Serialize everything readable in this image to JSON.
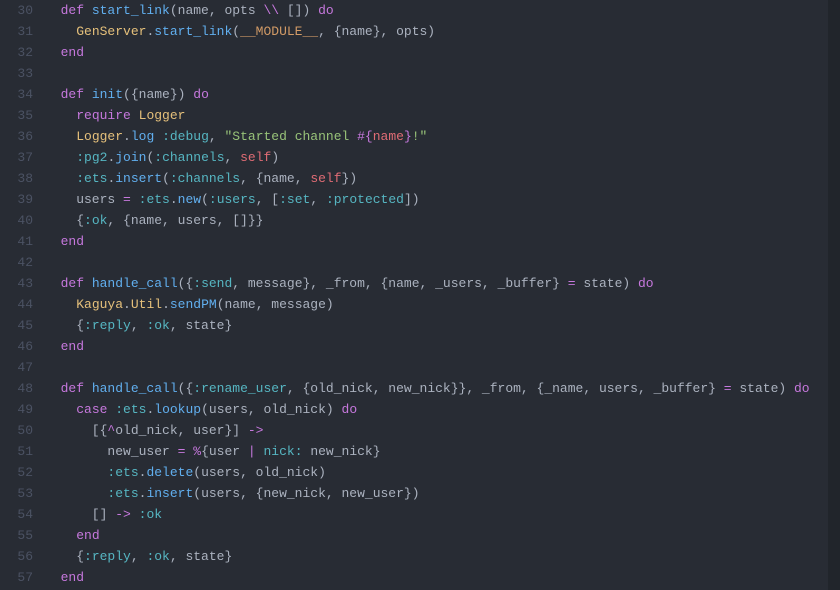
{
  "line_numbers": [
    "30",
    "31",
    "32",
    "33",
    "34",
    "35",
    "36",
    "37",
    "38",
    "39",
    "40",
    "41",
    "42",
    "43",
    "44",
    "45",
    "46",
    "47",
    "48",
    "49",
    "50",
    "51",
    "52",
    "53",
    "54",
    "55",
    "56",
    "57"
  ],
  "tokens": [
    [
      {
        "c": "punc",
        "t": "  "
      },
      {
        "c": "kw",
        "t": "def"
      },
      {
        "c": "punc",
        "t": " "
      },
      {
        "c": "fn",
        "t": "start_link"
      },
      {
        "c": "punc",
        "t": "(name, opts "
      },
      {
        "c": "op",
        "t": "\\\\"
      },
      {
        "c": "punc",
        "t": " []) "
      },
      {
        "c": "kw",
        "t": "do"
      }
    ],
    [
      {
        "c": "punc",
        "t": "    "
      },
      {
        "c": "mod",
        "t": "GenServer"
      },
      {
        "c": "punc",
        "t": "."
      },
      {
        "c": "fn",
        "t": "start_link"
      },
      {
        "c": "punc",
        "t": "("
      },
      {
        "c": "const",
        "t": "__MODULE__"
      },
      {
        "c": "punc",
        "t": ", {name}, opts)"
      }
    ],
    [
      {
        "c": "punc",
        "t": "  "
      },
      {
        "c": "kw",
        "t": "end"
      }
    ],
    [],
    [
      {
        "c": "punc",
        "t": "  "
      },
      {
        "c": "kw",
        "t": "def"
      },
      {
        "c": "punc",
        "t": " "
      },
      {
        "c": "fn",
        "t": "init"
      },
      {
        "c": "punc",
        "t": "({name}) "
      },
      {
        "c": "kw",
        "t": "do"
      }
    ],
    [
      {
        "c": "punc",
        "t": "    "
      },
      {
        "c": "kw",
        "t": "require"
      },
      {
        "c": "punc",
        "t": " "
      },
      {
        "c": "mod",
        "t": "Logger"
      }
    ],
    [
      {
        "c": "punc",
        "t": "    "
      },
      {
        "c": "mod",
        "t": "Logger"
      },
      {
        "c": "punc",
        "t": "."
      },
      {
        "c": "fn",
        "t": "log"
      },
      {
        "c": "punc",
        "t": " "
      },
      {
        "c": "atom",
        "t": ":debug"
      },
      {
        "c": "punc",
        "t": ", "
      },
      {
        "c": "str",
        "t": "\"Started channel "
      },
      {
        "c": "interp",
        "t": "#{"
      },
      {
        "c": "var",
        "t": "name"
      },
      {
        "c": "interp",
        "t": "}"
      },
      {
        "c": "str",
        "t": "!\""
      }
    ],
    [
      {
        "c": "punc",
        "t": "    "
      },
      {
        "c": "atom",
        "t": ":pg2"
      },
      {
        "c": "punc",
        "t": "."
      },
      {
        "c": "fn",
        "t": "join"
      },
      {
        "c": "punc",
        "t": "("
      },
      {
        "c": "atom",
        "t": ":channels"
      },
      {
        "c": "punc",
        "t": ", "
      },
      {
        "c": "var",
        "t": "self"
      },
      {
        "c": "punc",
        "t": ")"
      }
    ],
    [
      {
        "c": "punc",
        "t": "    "
      },
      {
        "c": "atom",
        "t": ":ets"
      },
      {
        "c": "punc",
        "t": "."
      },
      {
        "c": "fn",
        "t": "insert"
      },
      {
        "c": "punc",
        "t": "("
      },
      {
        "c": "atom",
        "t": ":channels"
      },
      {
        "c": "punc",
        "t": ", {name, "
      },
      {
        "c": "var",
        "t": "self"
      },
      {
        "c": "punc",
        "t": "})"
      }
    ],
    [
      {
        "c": "punc",
        "t": "    users "
      },
      {
        "c": "op",
        "t": "="
      },
      {
        "c": "punc",
        "t": " "
      },
      {
        "c": "atom",
        "t": ":ets"
      },
      {
        "c": "punc",
        "t": "."
      },
      {
        "c": "fn",
        "t": "new"
      },
      {
        "c": "punc",
        "t": "("
      },
      {
        "c": "atom",
        "t": ":users"
      },
      {
        "c": "punc",
        "t": ", ["
      },
      {
        "c": "atom",
        "t": ":set"
      },
      {
        "c": "punc",
        "t": ", "
      },
      {
        "c": "atom",
        "t": ":protected"
      },
      {
        "c": "punc",
        "t": "])"
      }
    ],
    [
      {
        "c": "punc",
        "t": "    {"
      },
      {
        "c": "atom",
        "t": ":ok"
      },
      {
        "c": "punc",
        "t": ", {name, users, []}}"
      }
    ],
    [
      {
        "c": "punc",
        "t": "  "
      },
      {
        "c": "kw",
        "t": "end"
      }
    ],
    [],
    [
      {
        "c": "punc",
        "t": "  "
      },
      {
        "c": "kw",
        "t": "def"
      },
      {
        "c": "punc",
        "t": " "
      },
      {
        "c": "fn",
        "t": "handle_call"
      },
      {
        "c": "punc",
        "t": "({"
      },
      {
        "c": "atom",
        "t": ":send"
      },
      {
        "c": "punc",
        "t": ", message}, _from, {name, _users, _buffer} "
      },
      {
        "c": "op",
        "t": "="
      },
      {
        "c": "punc",
        "t": " state) "
      },
      {
        "c": "kw",
        "t": "do"
      }
    ],
    [
      {
        "c": "punc",
        "t": "    "
      },
      {
        "c": "mod",
        "t": "Kaguya"
      },
      {
        "c": "punc",
        "t": "."
      },
      {
        "c": "mod",
        "t": "Util"
      },
      {
        "c": "punc",
        "t": "."
      },
      {
        "c": "fn",
        "t": "sendPM"
      },
      {
        "c": "punc",
        "t": "(name, message)"
      }
    ],
    [
      {
        "c": "punc",
        "t": "    {"
      },
      {
        "c": "atom",
        "t": ":reply"
      },
      {
        "c": "punc",
        "t": ", "
      },
      {
        "c": "atom",
        "t": ":ok"
      },
      {
        "c": "punc",
        "t": ", state}"
      }
    ],
    [
      {
        "c": "punc",
        "t": "  "
      },
      {
        "c": "kw",
        "t": "end"
      }
    ],
    [],
    [
      {
        "c": "punc",
        "t": "  "
      },
      {
        "c": "kw",
        "t": "def"
      },
      {
        "c": "punc",
        "t": " "
      },
      {
        "c": "fn",
        "t": "handle_call"
      },
      {
        "c": "punc",
        "t": "({"
      },
      {
        "c": "atom",
        "t": ":rename_user"
      },
      {
        "c": "punc",
        "t": ", {old_nick, new_nick}}, _from, {_name, users, _buffer} "
      },
      {
        "c": "op",
        "t": "="
      },
      {
        "c": "punc",
        "t": " state) "
      },
      {
        "c": "kw",
        "t": "do"
      }
    ],
    [
      {
        "c": "punc",
        "t": "    "
      },
      {
        "c": "kw",
        "t": "case"
      },
      {
        "c": "punc",
        "t": " "
      },
      {
        "c": "atom",
        "t": ":ets"
      },
      {
        "c": "punc",
        "t": "."
      },
      {
        "c": "fn",
        "t": "lookup"
      },
      {
        "c": "punc",
        "t": "(users, old_nick) "
      },
      {
        "c": "kw",
        "t": "do"
      }
    ],
    [
      {
        "c": "punc",
        "t": "      [{"
      },
      {
        "c": "op",
        "t": "^"
      },
      {
        "c": "punc",
        "t": "old_nick, user}] "
      },
      {
        "c": "op",
        "t": "->"
      }
    ],
    [
      {
        "c": "punc",
        "t": "        new_user "
      },
      {
        "c": "op",
        "t": "="
      },
      {
        "c": "punc",
        "t": " "
      },
      {
        "c": "op",
        "t": "%"
      },
      {
        "c": "punc",
        "t": "{user "
      },
      {
        "c": "op",
        "t": "|"
      },
      {
        "c": "punc",
        "t": " "
      },
      {
        "c": "atom",
        "t": "nick:"
      },
      {
        "c": "punc",
        "t": " new_nick}"
      }
    ],
    [
      {
        "c": "punc",
        "t": "        "
      },
      {
        "c": "atom",
        "t": ":ets"
      },
      {
        "c": "punc",
        "t": "."
      },
      {
        "c": "fn",
        "t": "delete"
      },
      {
        "c": "punc",
        "t": "(users, old_nick)"
      }
    ],
    [
      {
        "c": "punc",
        "t": "        "
      },
      {
        "c": "atom",
        "t": ":ets"
      },
      {
        "c": "punc",
        "t": "."
      },
      {
        "c": "fn",
        "t": "insert"
      },
      {
        "c": "punc",
        "t": "(users, {new_nick, new_user})"
      }
    ],
    [
      {
        "c": "punc",
        "t": "      [] "
      },
      {
        "c": "op",
        "t": "->"
      },
      {
        "c": "punc",
        "t": " "
      },
      {
        "c": "atom",
        "t": ":ok"
      }
    ],
    [
      {
        "c": "punc",
        "t": "    "
      },
      {
        "c": "kw",
        "t": "end"
      }
    ],
    [
      {
        "c": "punc",
        "t": "    {"
      },
      {
        "c": "atom",
        "t": ":reply"
      },
      {
        "c": "punc",
        "t": ", "
      },
      {
        "c": "atom",
        "t": ":ok"
      },
      {
        "c": "punc",
        "t": ", state}"
      }
    ],
    [
      {
        "c": "punc",
        "t": "  "
      },
      {
        "c": "kw",
        "t": "end"
      }
    ]
  ]
}
